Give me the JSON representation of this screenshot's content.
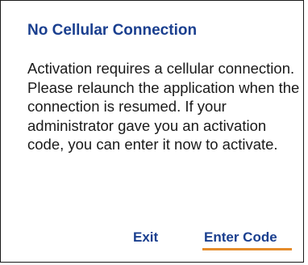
{
  "dialog": {
    "title": "No Cellular Connection",
    "message": "Activation requires a cellular connection. Please relaunch the application when the connection is resumed. If your administrator gave you an activation code, you can enter it now to activate.",
    "buttons": {
      "exit_label": "Exit",
      "enter_code_label": "Enter Code"
    }
  },
  "colors": {
    "accent": "#1a3f8f",
    "text": "#1a1a1a",
    "focus_indicator": "#e58b2a",
    "border": "#1a1a1a",
    "background": "#ffffff"
  }
}
